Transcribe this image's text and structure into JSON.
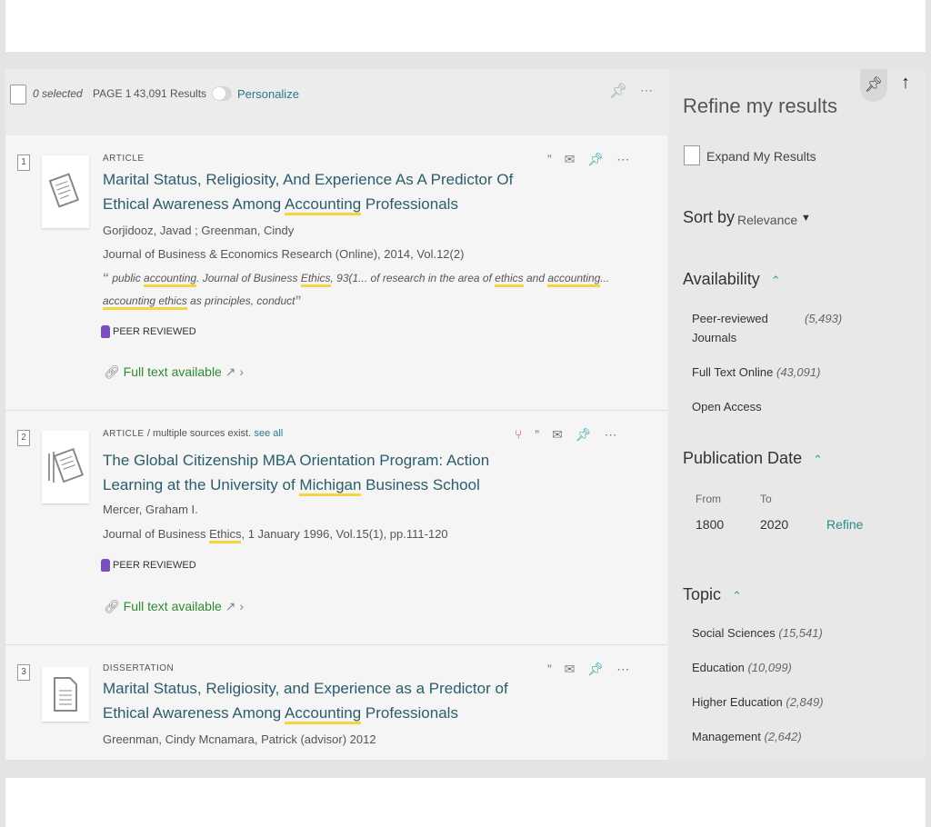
{
  "toolbar": {
    "selected": "0 selected",
    "page": "PAGE 1",
    "results": "43,091 Results",
    "personalize": "Personalize"
  },
  "results": [
    {
      "num": "1",
      "type": "ARTICLE",
      "title_a": "Marital Status, Religiosity, And Experience As A Predictor Of Ethical Awareness Among ",
      "title_hl": "Accounting",
      "title_b": " Professionals",
      "authors": "Gorjidooz, Javad ; Greenman, Cindy",
      "source": "Journal of Business & Economics Research (Online), 2014, Vol.12(2)",
      "snippet_1a": " public ",
      "snippet_1hl": "accounting",
      "snippet_1b": ". Journal of Business ",
      "snippet_1hl2": "Ethics",
      "snippet_1c": ", 93(1... of research in the area of ",
      "snippet_1hl3": "ethics",
      "snippet_1d": " and ",
      "snippet_1hl4": "accounting",
      "snippet_1e": "...",
      "snippet_2hl": "accounting ethics",
      "snippet_2b": " as principles, conduct",
      "peer": "PEER REVIEWED",
      "fulltext": "Full text available"
    },
    {
      "num": "2",
      "type": "ARTICLE",
      "type_sub": "/ multiple sources exist.",
      "type_link": "see all",
      "title_a": "The Global Citizenship MBA Orientation Program: Action Learning at the University of ",
      "title_hl": "Michigan",
      "title_b": " Business School",
      "authors": "Mercer, Graham I.",
      "source_a": "Journal of Business ",
      "source_hl": "Ethics",
      "source_b": ", 1 January 1996, Vol.15(1), pp.111-120",
      "peer": "PEER REVIEWED",
      "fulltext": "Full text available"
    },
    {
      "num": "3",
      "type": "DISSERTATION",
      "title_a": "Marital Status, Religiosity, and Experience as a Predictor of Ethical Awareness Among ",
      "title_hl": "Accounting",
      "title_b": " Professionals",
      "authors": "Greenman, Cindy Mcnamara, Patrick (advisor) 2012"
    }
  ],
  "sidebar": {
    "title": "Refine my results",
    "expand": "Expand My Results",
    "sort_label": "Sort by",
    "sort_value": "Relevance",
    "availability": {
      "heading": "Availability",
      "items": [
        {
          "label": "Peer-reviewed Journals",
          "count": "(5,493)"
        },
        {
          "label": "Full Text Online",
          "count": "(43,091)"
        },
        {
          "label": "Open Access",
          "count": ""
        }
      ]
    },
    "pubdate": {
      "heading": "Publication Date",
      "from_label": "From",
      "to_label": "To",
      "from_value": "1800",
      "to_value": "2020",
      "refine": "Refine"
    },
    "topic": {
      "heading": "Topic",
      "items": [
        {
          "label": "Social Sciences",
          "count": "(15,541)"
        },
        {
          "label": "Education",
          "count": "(10,099)"
        },
        {
          "label": "Higher Education",
          "count": "(2,849)"
        },
        {
          "label": "Management",
          "count": "(2,642)"
        }
      ]
    }
  }
}
